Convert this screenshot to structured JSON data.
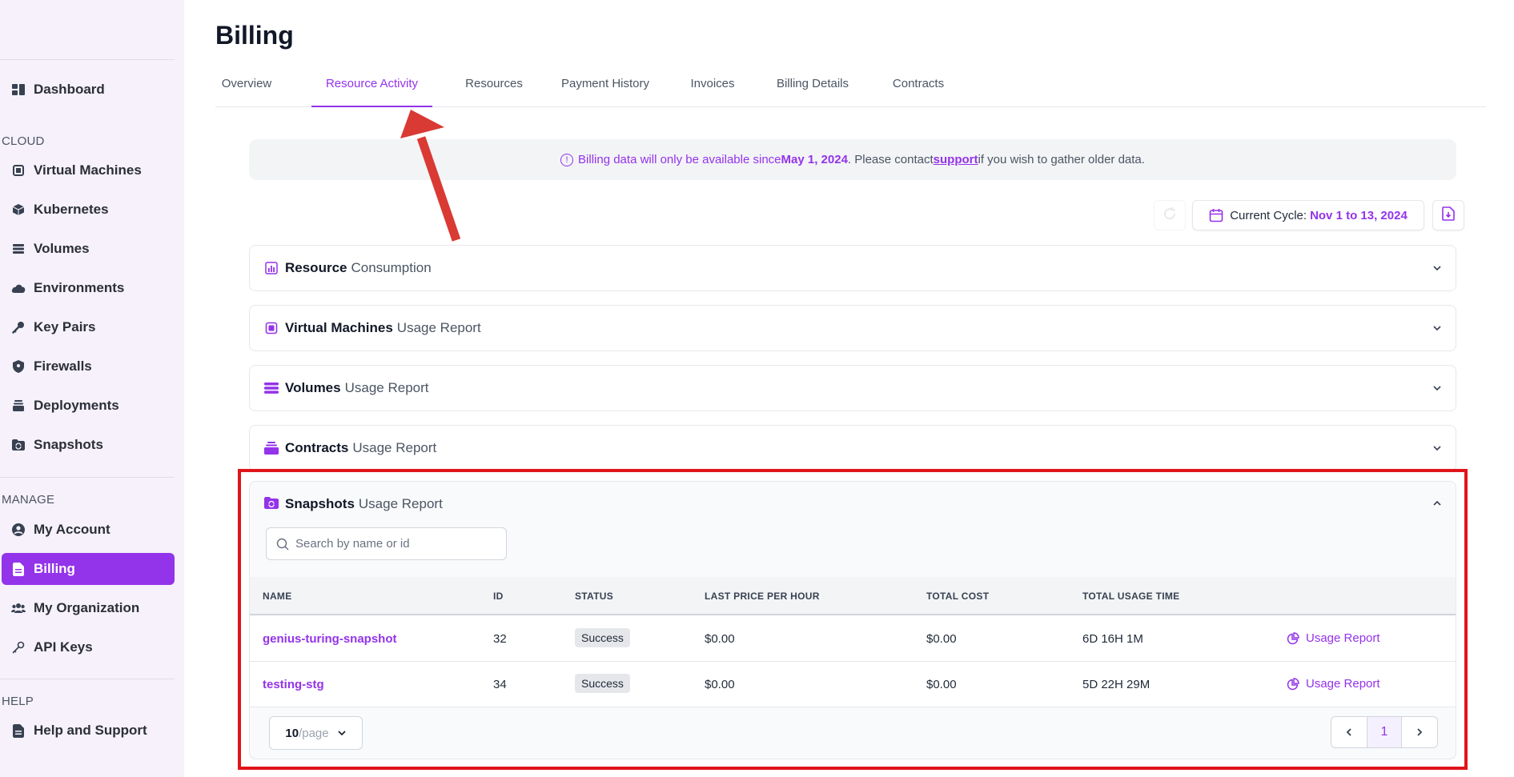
{
  "sidebar": {
    "items": [
      {
        "label": "Dashboard",
        "icon": "dashboard-icon"
      },
      {
        "label": "Virtual Machines",
        "icon": "chip-icon"
      },
      {
        "label": "Kubernetes",
        "icon": "cube-icon"
      },
      {
        "label": "Volumes",
        "icon": "database-icon"
      },
      {
        "label": "Environments",
        "icon": "cloud-icon"
      },
      {
        "label": "Key Pairs",
        "icon": "key-icon"
      },
      {
        "label": "Firewalls",
        "icon": "shield-icon"
      },
      {
        "label": "Deployments",
        "icon": "stack-icon"
      },
      {
        "label": "Snapshots",
        "icon": "folder-sync-icon"
      },
      {
        "label": "My Account",
        "icon": "user-circle-icon"
      },
      {
        "label": "Billing",
        "icon": "document-icon"
      },
      {
        "label": "My Organization",
        "icon": "users-icon"
      },
      {
        "label": "API Keys",
        "icon": "key-outline-icon"
      },
      {
        "label": "Help and Support",
        "icon": "help-document-icon"
      }
    ],
    "sections": {
      "cloud": "CLOUD",
      "manage": "MANAGE",
      "help": "HELP"
    },
    "active": "Billing"
  },
  "page": {
    "title": "Billing"
  },
  "tabs": [
    "Overview",
    "Resource Activity",
    "Resources",
    "Payment History",
    "Invoices",
    "Billing Details",
    "Contracts"
  ],
  "active_tab": "Resource Activity",
  "notice": {
    "text_before": "Billing data will only be available since ",
    "date": "May 1, 2024",
    "text_middle": ". Please contact ",
    "link": "support",
    "text_after": " if you wish to gather older data."
  },
  "toolbar": {
    "cycle_label": "Current Cycle:",
    "cycle_value": "Nov 1 to 13, 2024"
  },
  "accordions": [
    {
      "bold": "Resource",
      "light": "Consumption",
      "icon": "chart-icon"
    },
    {
      "bold": "Virtual Machines",
      "light": "Usage Report",
      "icon": "chip-icon"
    },
    {
      "bold": "Volumes",
      "light": "Usage Report",
      "icon": "database-icon"
    },
    {
      "bold": "Contracts",
      "light": "Usage Report",
      "icon": "stack-icon"
    }
  ],
  "snapshots": {
    "bold": "Snapshots",
    "light": "Usage Report",
    "search_placeholder": "Search by name or id",
    "columns": [
      "NAME",
      "ID",
      "STATUS",
      "LAST PRICE PER HOUR",
      "TOTAL COST",
      "TOTAL USAGE TIME"
    ],
    "rows": [
      {
        "name": "genius-turing-snapshot",
        "id": "32",
        "status": "Success",
        "price": "$0.00",
        "cost": "$0.00",
        "time": "6D 16H 1M",
        "action": "Usage Report"
      },
      {
        "name": "testing-stg",
        "id": "34",
        "status": "Success",
        "price": "$0.00",
        "cost": "$0.00",
        "time": "5D 22H 29M",
        "action": "Usage Report"
      }
    ],
    "page_size": "10",
    "page_size_unit": "/page",
    "current_page": "1"
  },
  "colors": {
    "accent": "#9333ea",
    "highlight": "#e0141b"
  }
}
